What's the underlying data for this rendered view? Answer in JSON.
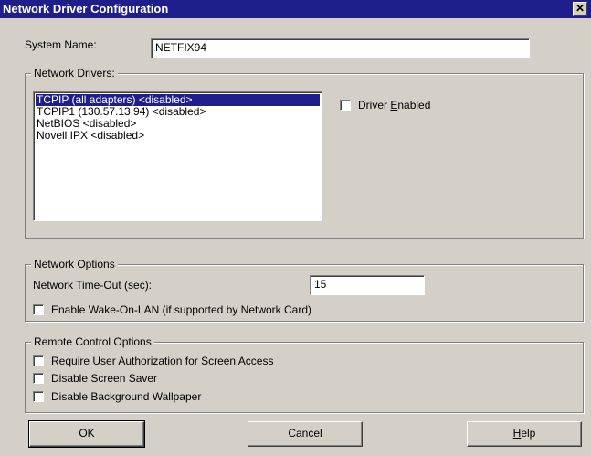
{
  "window": {
    "title": "Network Driver Configuration",
    "close_glyph": "✕"
  },
  "system_name": {
    "label": "System Name:",
    "value": "NETFIX94"
  },
  "network_drivers": {
    "group_title": "Network Drivers:",
    "items": [
      {
        "label": "TCPIP (all adapters) <disabled>",
        "selected": true
      },
      {
        "label": "TCPIP1 (130.57.13.94) <disabled>",
        "selected": false
      },
      {
        "label": "NetBIOS <disabled>",
        "selected": false
      },
      {
        "label": "Novell IPX <disabled>",
        "selected": false
      }
    ],
    "driver_enabled": {
      "pre": "Driver ",
      "accel": "E",
      "post": "nabled",
      "checked": false
    }
  },
  "network_options": {
    "group_title": "Network Options",
    "timeout_label": "Network Time-Out (sec):",
    "timeout_value": "15",
    "wake_on_lan": {
      "label": "Enable Wake-On-LAN (if supported by Network Card)",
      "checked": false
    }
  },
  "remote_control": {
    "group_title": "Remote Control Options",
    "options": [
      {
        "label": "Require User Authorization for Screen Access",
        "checked": false
      },
      {
        "label": "Disable Screen Saver",
        "checked": false
      },
      {
        "label": "Disable Background Wallpaper",
        "checked": false
      }
    ]
  },
  "buttons": {
    "ok": "OK",
    "cancel": "Cancel",
    "help_accel": "H",
    "help_rest": "elp"
  },
  "colors": {
    "titlebar": "#1f1f8c",
    "face": "#d4d0c8",
    "selection": "#1f1f8c"
  }
}
